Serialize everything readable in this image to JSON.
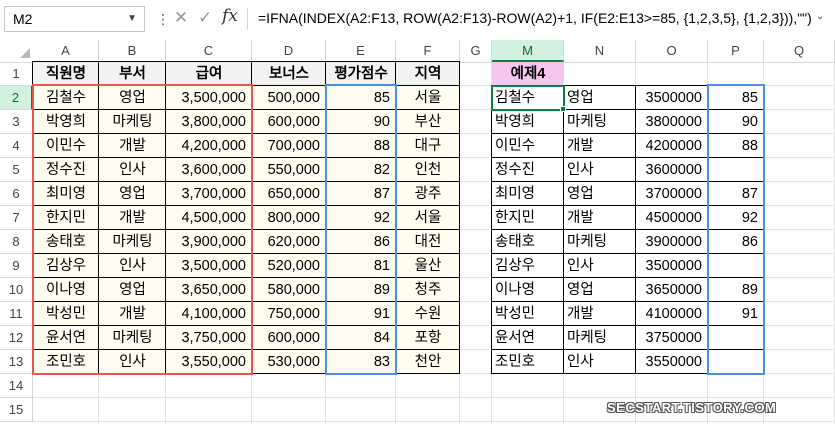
{
  "formula_bar": {
    "name_box": "M2",
    "cancel_symbol": "✕",
    "enter_symbol": "✓",
    "fx_label": "fx",
    "formula": "=IFNA(INDEX(A2:F13, ROW(A2:F13)-ROW(A2)+1, IF(E2:E13>=85, {1,2,3,5}, {1,2,3})),\"\")"
  },
  "columns": [
    "A",
    "B",
    "C",
    "D",
    "E",
    "F",
    "G",
    "M",
    "N",
    "O",
    "P",
    "Q"
  ],
  "selected_column": "M",
  "rows": [
    "1",
    "2",
    "3",
    "4",
    "5",
    "6",
    "7",
    "8",
    "9",
    "10",
    "11",
    "12",
    "13",
    "14",
    "15"
  ],
  "selected_row": "2",
  "headers": {
    "name": "직원명",
    "dept": "부서",
    "salary": "급여",
    "bonus": "보너스",
    "score": "평가점수",
    "region": "지역",
    "example": "예제4"
  },
  "table": [
    {
      "name": "김철수",
      "dept": "영업",
      "salary": "3,500,000",
      "bonus": "500,000",
      "score": "85",
      "region": "서울"
    },
    {
      "name": "박영희",
      "dept": "마케팅",
      "salary": "3,800,000",
      "bonus": "600,000",
      "score": "90",
      "region": "부산"
    },
    {
      "name": "이민수",
      "dept": "개발",
      "salary": "4,200,000",
      "bonus": "700,000",
      "score": "88",
      "region": "대구"
    },
    {
      "name": "정수진",
      "dept": "인사",
      "salary": "3,600,000",
      "bonus": "550,000",
      "score": "82",
      "region": "인천"
    },
    {
      "name": "최미영",
      "dept": "영업",
      "salary": "3,700,000",
      "bonus": "650,000",
      "score": "87",
      "region": "광주"
    },
    {
      "name": "한지민",
      "dept": "개발",
      "salary": "4,500,000",
      "bonus": "800,000",
      "score": "92",
      "region": "서울"
    },
    {
      "name": "송태호",
      "dept": "마케팅",
      "salary": "3,900,000",
      "bonus": "620,000",
      "score": "86",
      "region": "대전"
    },
    {
      "name": "김상우",
      "dept": "인사",
      "salary": "3,500,000",
      "bonus": "520,000",
      "score": "81",
      "region": "울산"
    },
    {
      "name": "이나영",
      "dept": "영업",
      "salary": "3,650,000",
      "bonus": "580,000",
      "score": "89",
      "region": "청주"
    },
    {
      "name": "박성민",
      "dept": "개발",
      "salary": "4,100,000",
      "bonus": "750,000",
      "score": "91",
      "region": "수원"
    },
    {
      "name": "윤서연",
      "dept": "마케팅",
      "salary": "3,750,000",
      "bonus": "600,000",
      "score": "84",
      "region": "포항"
    },
    {
      "name": "조민호",
      "dept": "인사",
      "salary": "3,550,000",
      "bonus": "530,000",
      "score": "83",
      "region": "천안"
    }
  ],
  "result": [
    {
      "name": "김철수",
      "dept": "영업",
      "salary": "3500000",
      "score": "85"
    },
    {
      "name": "박영희",
      "dept": "마케팅",
      "salary": "3800000",
      "score": "90"
    },
    {
      "name": "이민수",
      "dept": "개발",
      "salary": "4200000",
      "score": "88"
    },
    {
      "name": "정수진",
      "dept": "인사",
      "salary": "3600000",
      "score": ""
    },
    {
      "name": "최미영",
      "dept": "영업",
      "salary": "3700000",
      "score": "87"
    },
    {
      "name": "한지민",
      "dept": "개발",
      "salary": "4500000",
      "score": "92"
    },
    {
      "name": "송태호",
      "dept": "마케팅",
      "salary": "3900000",
      "score": "86"
    },
    {
      "name": "김상우",
      "dept": "인사",
      "salary": "3500000",
      "score": ""
    },
    {
      "name": "이나영",
      "dept": "영업",
      "salary": "3650000",
      "score": "89"
    },
    {
      "name": "박성민",
      "dept": "개발",
      "salary": "4100000",
      "score": "91"
    },
    {
      "name": "윤서연",
      "dept": "마케팅",
      "salary": "3750000",
      "score": ""
    },
    {
      "name": "조민호",
      "dept": "인사",
      "salary": "3550000",
      "score": ""
    }
  ],
  "watermark": "SECSTART.TISTORY.COM",
  "colors": {
    "red_box": "#e8574f",
    "blue_box": "#4d8fe0",
    "example_fill": "#f7c6f0",
    "yellow_fill": "#fffdf0",
    "header_fill": "#f2f2f2",
    "select_green": "#107c41"
  }
}
